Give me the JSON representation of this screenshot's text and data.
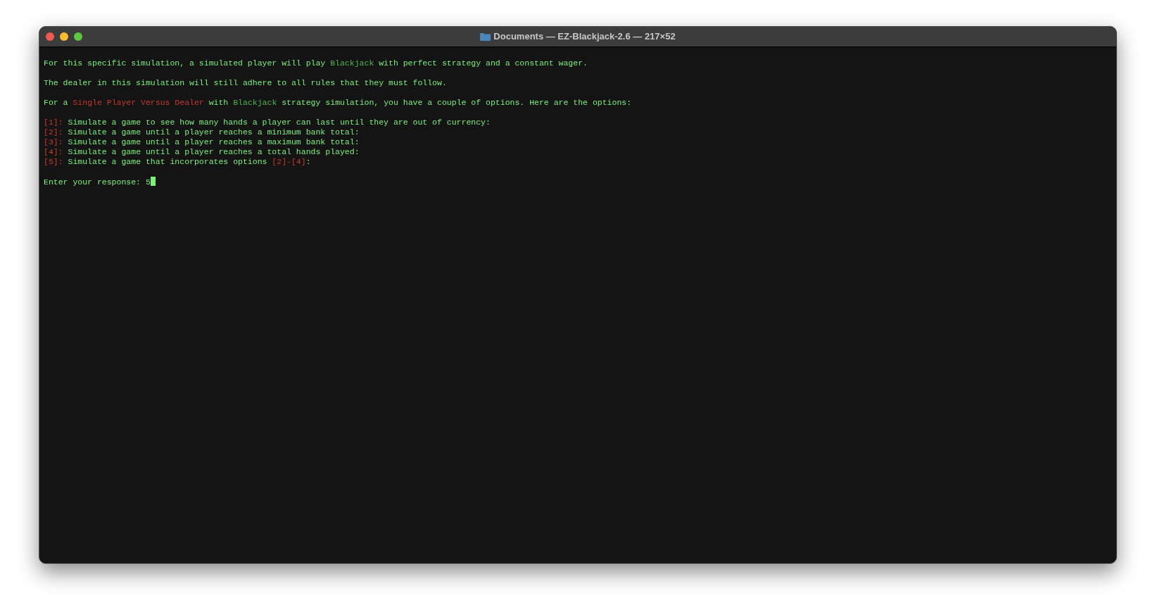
{
  "window": {
    "title": "Documents — EZ-Blackjack-2.6 — 217×52"
  },
  "lines": [
    {
      "kind": "output",
      "segments": [
        {
          "text": "For this specific simulation, a simulated player will play ",
          "kind": "plain"
        },
        {
          "text": "Blackjack",
          "kind": "game"
        },
        {
          "text": " with perfect strategy and a constant wager.",
          "kind": "plain"
        }
      ]
    },
    {
      "kind": "blank"
    },
    {
      "kind": "output",
      "segments": [
        {
          "text": "The dealer in this simulation will still adhere to all rules that they must follow.",
          "kind": "plain"
        }
      ]
    },
    {
      "kind": "blank"
    },
    {
      "kind": "output",
      "segments": [
        {
          "text": "For a ",
          "kind": "plain"
        },
        {
          "text": "Single Player Versus Dealer",
          "kind": "option"
        },
        {
          "text": " with ",
          "kind": "plain"
        },
        {
          "text": "Blackjack",
          "kind": "game"
        },
        {
          "text": " strategy simulation, you have a couple of options. Here are the options:",
          "kind": "plain"
        }
      ]
    },
    {
      "kind": "blank"
    },
    {
      "kind": "output",
      "segments": [
        {
          "text": "[1]:",
          "kind": "option"
        },
        {
          "text": " Simulate a game to see how many hands a player can last until they are out of currency:",
          "kind": "plain"
        }
      ]
    },
    {
      "kind": "output",
      "segments": [
        {
          "text": "[2]:",
          "kind": "option"
        },
        {
          "text": " Simulate a game until a player reaches a minimum bank total:",
          "kind": "plain"
        }
      ]
    },
    {
      "kind": "output",
      "segments": [
        {
          "text": "[3]:",
          "kind": "option"
        },
        {
          "text": " Simulate a game until a player reaches a maximum bank total:",
          "kind": "plain"
        }
      ]
    },
    {
      "kind": "output",
      "segments": [
        {
          "text": "[4]:",
          "kind": "option"
        },
        {
          "text": " Simulate a game until a player reaches a total hands played:",
          "kind": "plain"
        }
      ]
    },
    {
      "kind": "output",
      "segments": [
        {
          "text": "[5]:",
          "kind": "option"
        },
        {
          "text": " Simulate a game that incorporates options ",
          "kind": "plain"
        },
        {
          "text": "[2]-[4]",
          "kind": "option"
        },
        {
          "text": ":",
          "kind": "plain"
        }
      ]
    },
    {
      "kind": "blank"
    },
    {
      "kind": "prompt",
      "segments": [
        {
          "text": "Enter your response: ",
          "kind": "plain"
        },
        {
          "text": "5",
          "kind": "plain"
        }
      ]
    }
  ]
}
